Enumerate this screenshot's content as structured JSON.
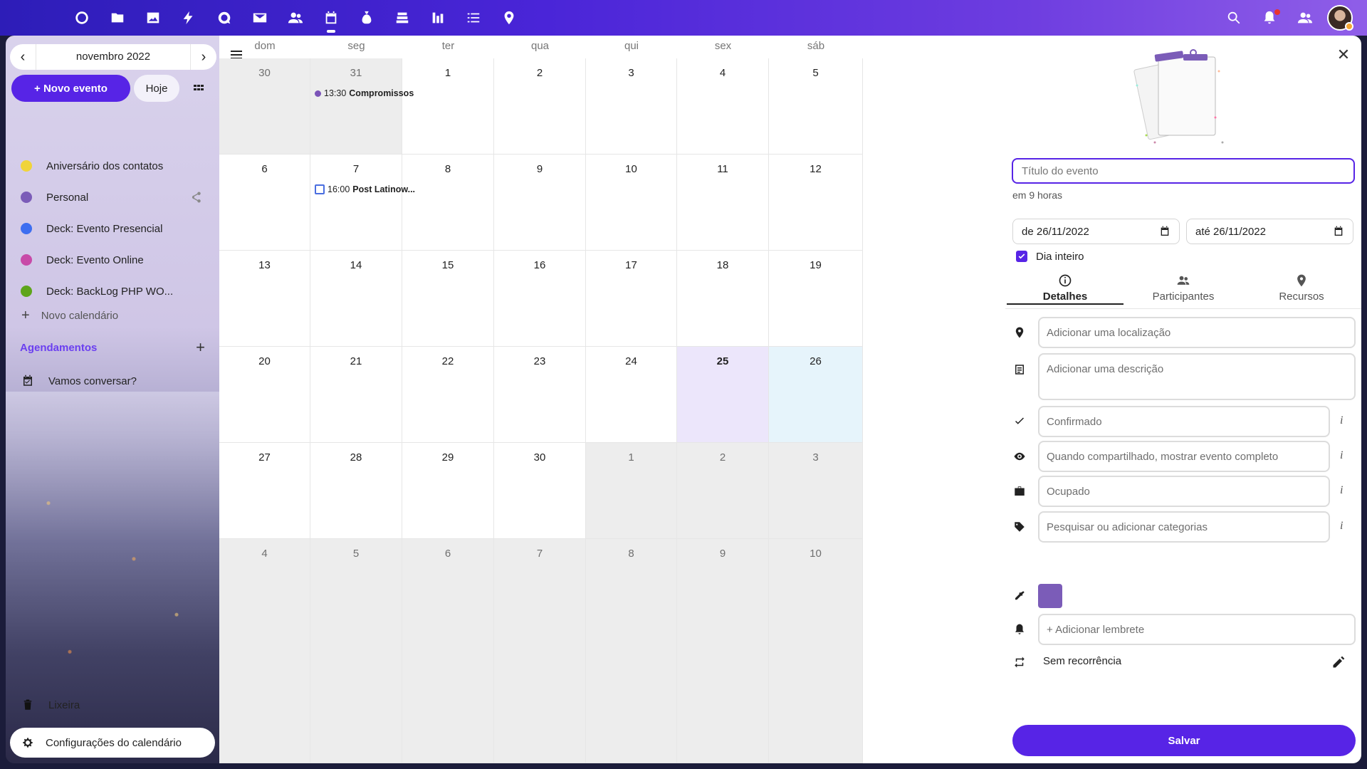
{
  "topbar": {
    "apps": [
      {
        "icon": "dashboard-icon",
        "name": "dashboard"
      },
      {
        "icon": "files-icon",
        "name": "files"
      },
      {
        "icon": "photos-icon",
        "name": "photos"
      },
      {
        "icon": "activity-icon",
        "name": "activity"
      },
      {
        "icon": "talk-icon",
        "name": "talk"
      },
      {
        "icon": "mail-icon",
        "name": "mail"
      },
      {
        "icon": "contacts-icon",
        "name": "contacts"
      },
      {
        "icon": "calendar-icon",
        "name": "calendar",
        "active": true
      },
      {
        "icon": "money-icon",
        "name": "cospend"
      },
      {
        "icon": "deck-icon",
        "name": "deck"
      },
      {
        "icon": "analytics-icon",
        "name": "analytics"
      },
      {
        "icon": "tasks-icon",
        "name": "tasks"
      },
      {
        "icon": "maps-icon",
        "name": "maps"
      }
    ],
    "right_icons": [
      "search-icon",
      "notifications-icon",
      "contacts-menu-icon"
    ]
  },
  "sidebar": {
    "month_label": "novembro 2022",
    "new_event_label": "+ Novo evento",
    "today_label": "Hoje",
    "calendars": [
      {
        "name": "Aniversário dos contatos",
        "color": "#f0d43a"
      },
      {
        "name": "Personal",
        "color": "#7b5cb8",
        "shared": true
      },
      {
        "name": "Deck: Evento Presencial",
        "color": "#3d6ef0"
      },
      {
        "name": "Deck: Evento Online",
        "color": "#c84aa8"
      },
      {
        "name": "Deck: BackLog PHP WO...",
        "color": "#5ea51b"
      }
    ],
    "new_calendar_label": "Novo calendário",
    "appointments_title": "Agendamentos",
    "appointment_item": "Vamos conversar?",
    "trash_label": "Lixeira",
    "settings_label": "Configurações do calendário"
  },
  "calendar": {
    "weekdays": [
      "dom",
      "seg",
      "ter",
      "qua",
      "qui",
      "sex",
      "sáb"
    ],
    "weeks": [
      [
        {
          "n": "30",
          "muted": true
        },
        {
          "n": "31",
          "muted": true
        },
        {
          "n": "1"
        },
        {
          "n": "2"
        },
        {
          "n": "3"
        },
        {
          "n": "4"
        },
        {
          "n": "5"
        }
      ],
      [
        {
          "n": "6"
        },
        {
          "n": "7"
        },
        {
          "n": "8"
        },
        {
          "n": "9"
        },
        {
          "n": "10"
        },
        {
          "n": "11"
        },
        {
          "n": "12"
        }
      ],
      [
        {
          "n": "13"
        },
        {
          "n": "14"
        },
        {
          "n": "15"
        },
        {
          "n": "16"
        },
        {
          "n": "17"
        },
        {
          "n": "18"
        },
        {
          "n": "19"
        }
      ],
      [
        {
          "n": "20"
        },
        {
          "n": "21"
        },
        {
          "n": "22"
        },
        {
          "n": "23"
        },
        {
          "n": "24"
        },
        {
          "n": "25",
          "today": true
        },
        {
          "n": "26",
          "selected": true
        }
      ],
      [
        {
          "n": "27"
        },
        {
          "n": "28"
        },
        {
          "n": "29"
        },
        {
          "n": "30"
        },
        {
          "n": "1",
          "muted": true
        },
        {
          "n": "2",
          "muted": true
        },
        {
          "n": "3",
          "muted": true
        }
      ],
      [
        {
          "n": "4",
          "muted": true
        },
        {
          "n": "5",
          "muted": true
        },
        {
          "n": "6",
          "muted": true
        },
        {
          "n": "7",
          "muted": true
        },
        {
          "n": "8",
          "muted": true
        },
        {
          "n": "9",
          "muted": true
        },
        {
          "n": "10",
          "muted": true
        }
      ]
    ],
    "events": [
      {
        "week": 0,
        "day": 1,
        "time": "13:30",
        "title": "Compromissos",
        "style": "dot"
      },
      {
        "week": 1,
        "day": 1,
        "time": "16:00",
        "title": "Post Latinow...",
        "style": "checkbox"
      }
    ]
  },
  "panel": {
    "title_placeholder": "Título do evento",
    "relative_time": "em 9 horas",
    "date_from": "de 26/11/2022",
    "date_to": "até 26/11/2022",
    "all_day_label": "Dia inteiro",
    "tabs": [
      {
        "label": "Detalhes",
        "icon": "info-icon",
        "active": true
      },
      {
        "label": "Participantes",
        "icon": "people-icon"
      },
      {
        "label": "Recursos",
        "icon": "map-marker-icon"
      }
    ],
    "location_placeholder": "Adicionar uma localização",
    "description_placeholder": "Adicionar uma descrição",
    "status_value": "Confirmado",
    "visibility_value": "Quando compartilhado, mostrar evento completo",
    "availability_value": "Ocupado",
    "categories_placeholder": "Pesquisar ou adicionar categorias",
    "event_color": "#7b5cb8",
    "reminder_label": "+ Adicionar lembrete",
    "recurrence_label": "Sem recorrência",
    "info_glyph": "i",
    "save_label": "Salvar"
  }
}
